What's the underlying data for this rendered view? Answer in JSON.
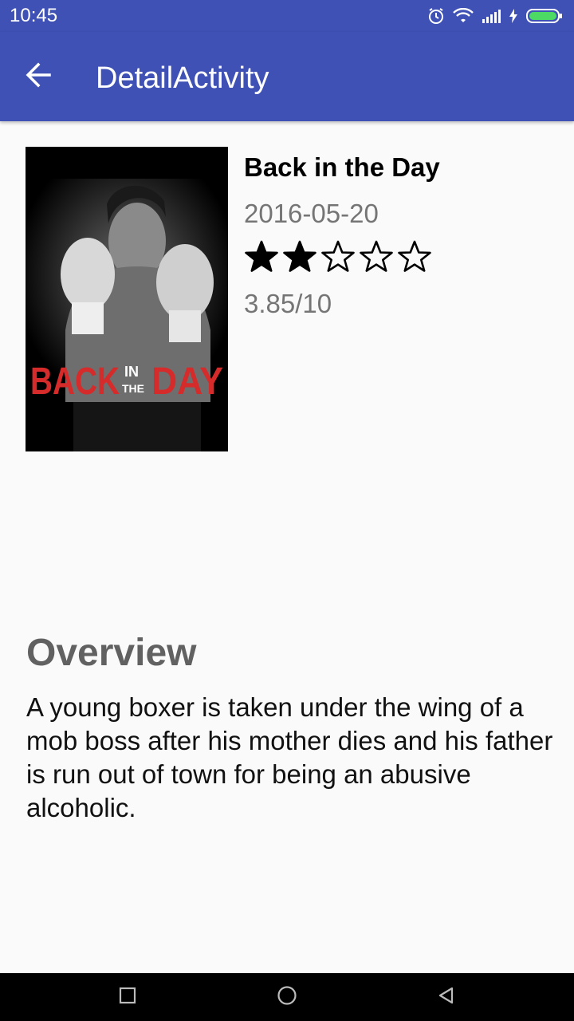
{
  "status_bar": {
    "time": "10:45",
    "icons": [
      "alarm-icon",
      "wifi-icon",
      "signal-icon",
      "charging-icon",
      "battery-icon"
    ],
    "battery_color": "#4cd964"
  },
  "app_bar": {
    "title": "DetailActivity",
    "back_icon": "arrow-back-icon",
    "background": "#3f51b5"
  },
  "movie": {
    "poster_text": {
      "left": "BACK",
      "middle_top": "IN",
      "middle_bottom": "THE",
      "right": "DAY"
    },
    "title": "Back in the Day",
    "release_date": "2016-05-20",
    "rating_stars_filled": 2,
    "rating_stars_total": 5,
    "rating_text": "3.85/10"
  },
  "overview": {
    "heading": "Overview",
    "text": "A young boxer is taken under the wing of a mob boss after his mother dies and his father is run out of town for being an abusive alcoholic."
  },
  "nav_bar": {
    "buttons": [
      "recents-icon",
      "home-icon",
      "back-icon"
    ]
  }
}
